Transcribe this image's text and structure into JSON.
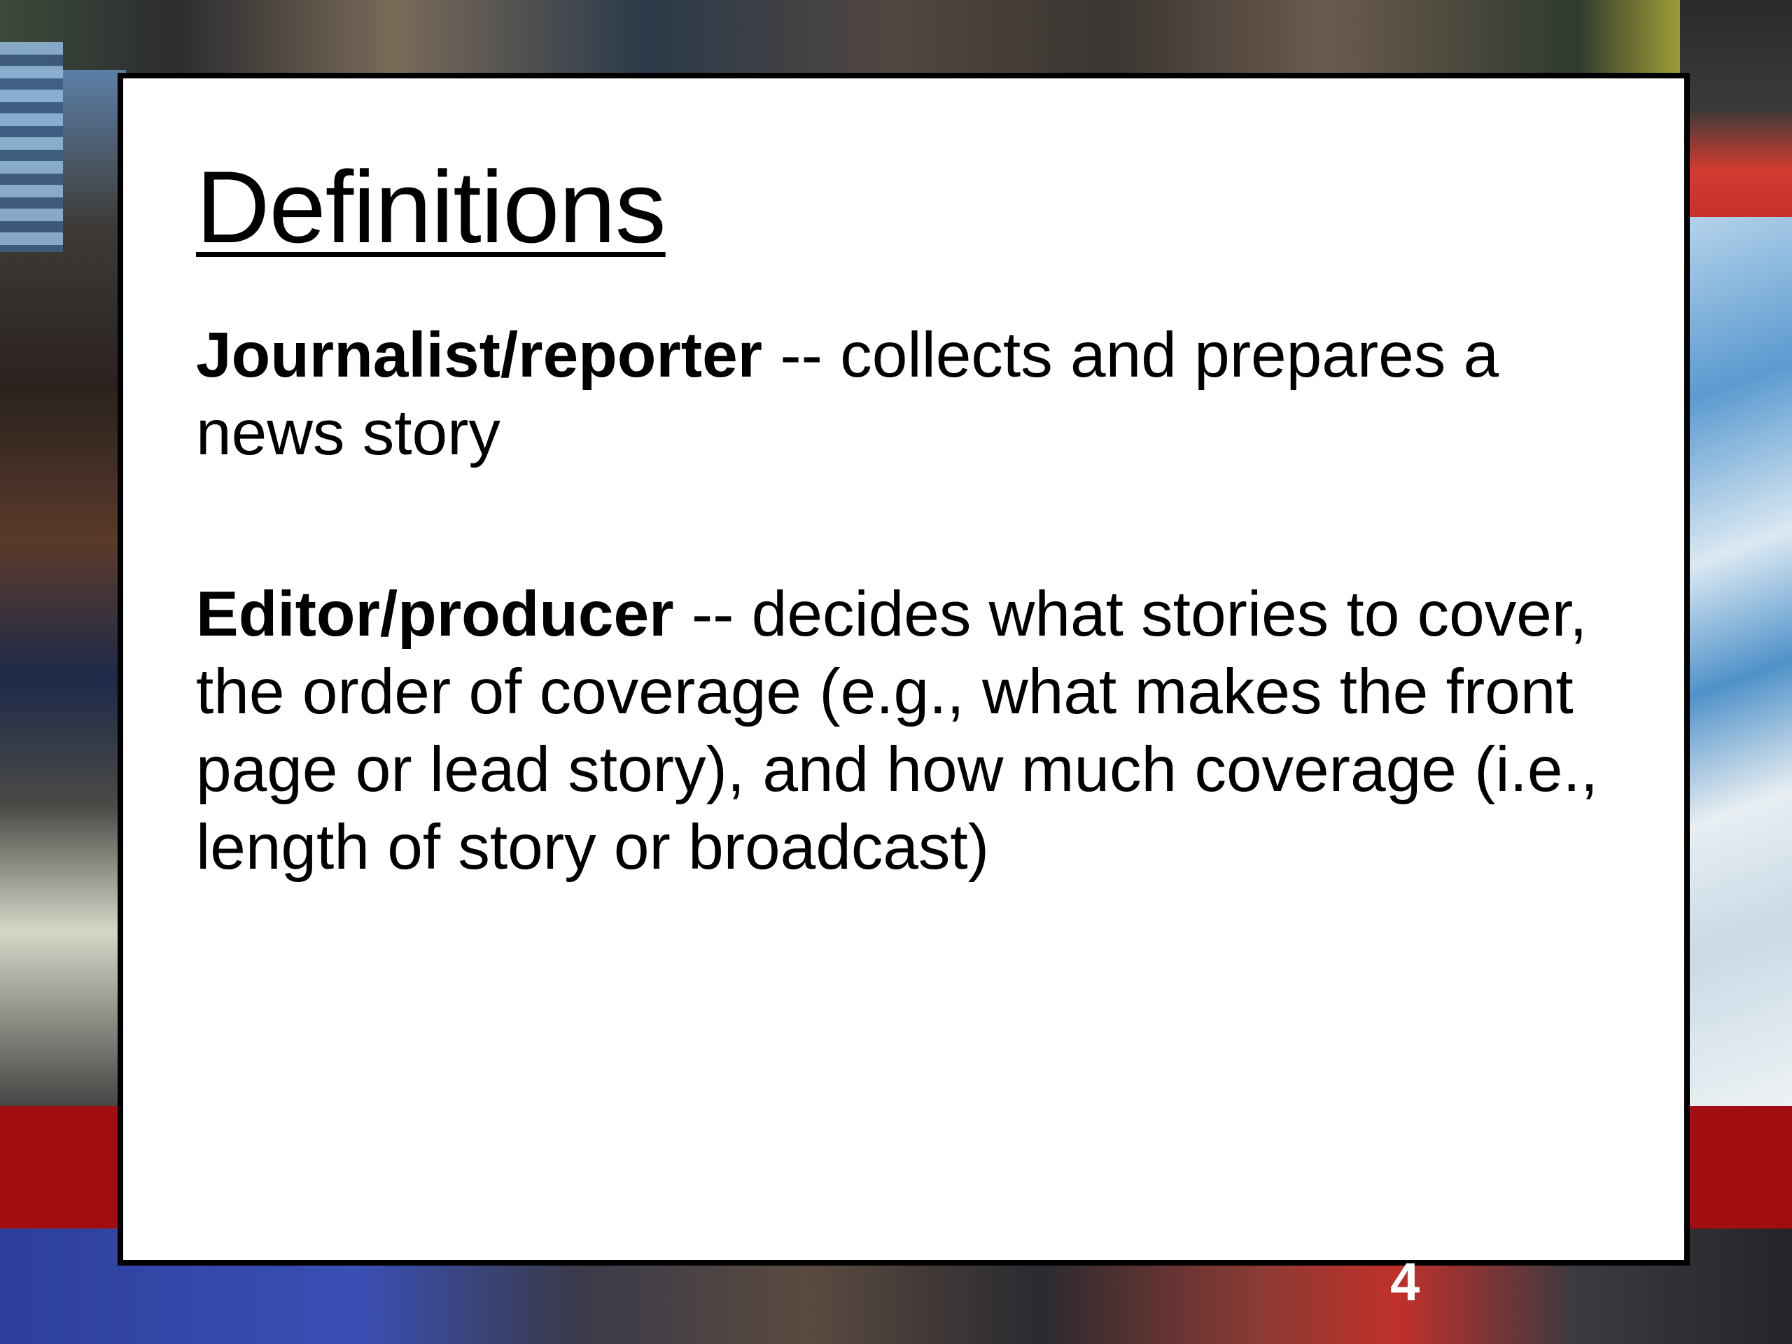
{
  "slide": {
    "title": "Definitions",
    "definitions": [
      {
        "term": "Journalist/reporter",
        "text": " -- collects and prepares a news story"
      },
      {
        "term": "Editor/producer",
        "text": " -- decides what stories to cover, the order of coverage (e.g., what makes the front page or lead story), and how much coverage (i.e., length of story or broadcast)"
      }
    ],
    "page_number": "4"
  },
  "colors": {
    "slide_background": "#ffffff",
    "slide_border": "#000000",
    "accent_band": "#a10e12",
    "page_number": "#ffffff"
  }
}
